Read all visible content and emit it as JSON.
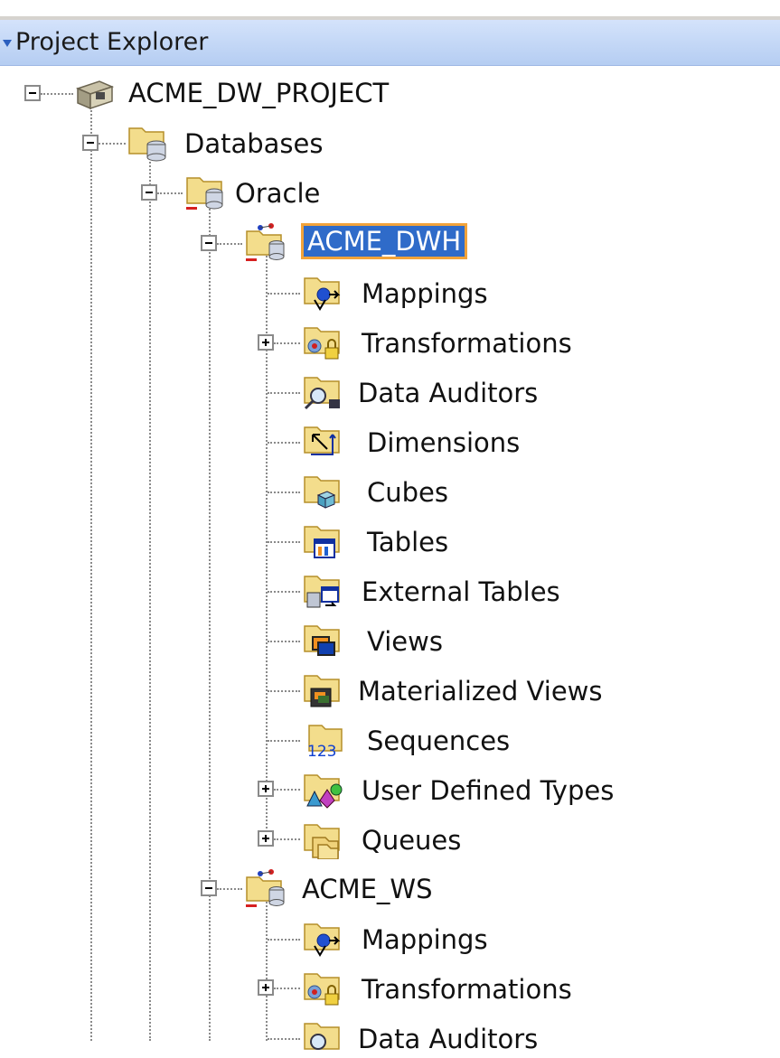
{
  "panel": {
    "title": "Project Explorer"
  },
  "tree": {
    "project": {
      "label": "ACME_DW_PROJECT",
      "icon": "project-icon"
    },
    "databases": {
      "label": "Databases",
      "icon": "databases-folder-icon"
    },
    "oracle": {
      "label": "Oracle",
      "icon": "oracle-folder-icon"
    },
    "acme_dwh": {
      "label": "ACME_DWH",
      "icon": "oracle-module-icon",
      "selected": true,
      "children": [
        {
          "label": "Mappings",
          "icon": "mappings-folder-icon",
          "expander": "none"
        },
        {
          "label": "Transformations",
          "icon": "transformations-folder-icon",
          "expander": "plus"
        },
        {
          "label": "Data Auditors",
          "icon": "data-auditors-folder-icon",
          "expander": "none"
        },
        {
          "label": "Dimensions",
          "icon": "dimensions-folder-icon",
          "expander": "none"
        },
        {
          "label": "Cubes",
          "icon": "cubes-folder-icon",
          "expander": "none"
        },
        {
          "label": "Tables",
          "icon": "tables-folder-icon",
          "expander": "none"
        },
        {
          "label": "External Tables",
          "icon": "external-tables-folder-icon",
          "expander": "none"
        },
        {
          "label": "Views",
          "icon": "views-folder-icon",
          "expander": "none"
        },
        {
          "label": "Materialized Views",
          "icon": "materialized-views-folder-icon",
          "expander": "none"
        },
        {
          "label": "Sequences",
          "icon": "sequences-folder-icon",
          "expander": "none"
        },
        {
          "label": "User Defined Types",
          "icon": "user-defined-types-folder-icon",
          "expander": "plus"
        },
        {
          "label": "Queues",
          "icon": "queues-folder-icon",
          "expander": "plus"
        }
      ]
    },
    "acme_ws": {
      "label": "ACME_WS",
      "icon": "oracle-module-icon",
      "children": [
        {
          "label": "Mappings",
          "icon": "mappings-folder-icon",
          "expander": "none"
        },
        {
          "label": "Transformations",
          "icon": "transformations-folder-icon",
          "expander": "plus"
        },
        {
          "label": "Data Auditors",
          "icon": "data-auditors-folder-icon",
          "expander": "none"
        }
      ]
    }
  }
}
